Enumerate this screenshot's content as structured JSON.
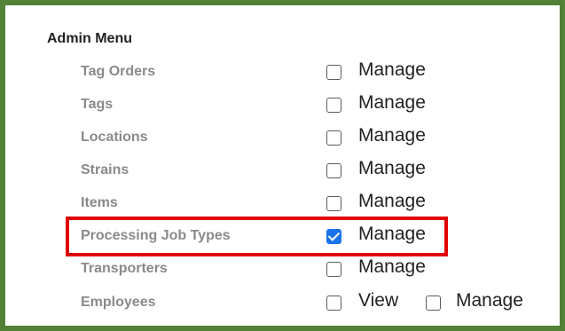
{
  "admin_menu": {
    "title": "Admin Menu",
    "rows": [
      {
        "label": "Tag Orders",
        "manage_label": "Manage",
        "manage_checked": false
      },
      {
        "label": "Tags",
        "manage_label": "Manage",
        "manage_checked": false
      },
      {
        "label": "Locations",
        "manage_label": "Manage",
        "manage_checked": false
      },
      {
        "label": "Strains",
        "manage_label": "Manage",
        "manage_checked": false
      },
      {
        "label": "Items",
        "manage_label": "Manage",
        "manage_checked": false
      },
      {
        "label": "Processing Job Types",
        "manage_label": "Manage",
        "manage_checked": true
      },
      {
        "label": "Transporters",
        "manage_label": "Manage",
        "manage_checked": false
      },
      {
        "label": "Employees",
        "view_label": "View",
        "view_checked": false,
        "manage_label": "Manage",
        "manage_checked": false
      }
    ]
  },
  "highlight": {
    "color": "#e00000",
    "target": "Processing Job Types"
  },
  "colors": {
    "frame_border": "#538135",
    "checkbox_checked": "#1a73e8",
    "label_text": "#8a8a8a"
  }
}
